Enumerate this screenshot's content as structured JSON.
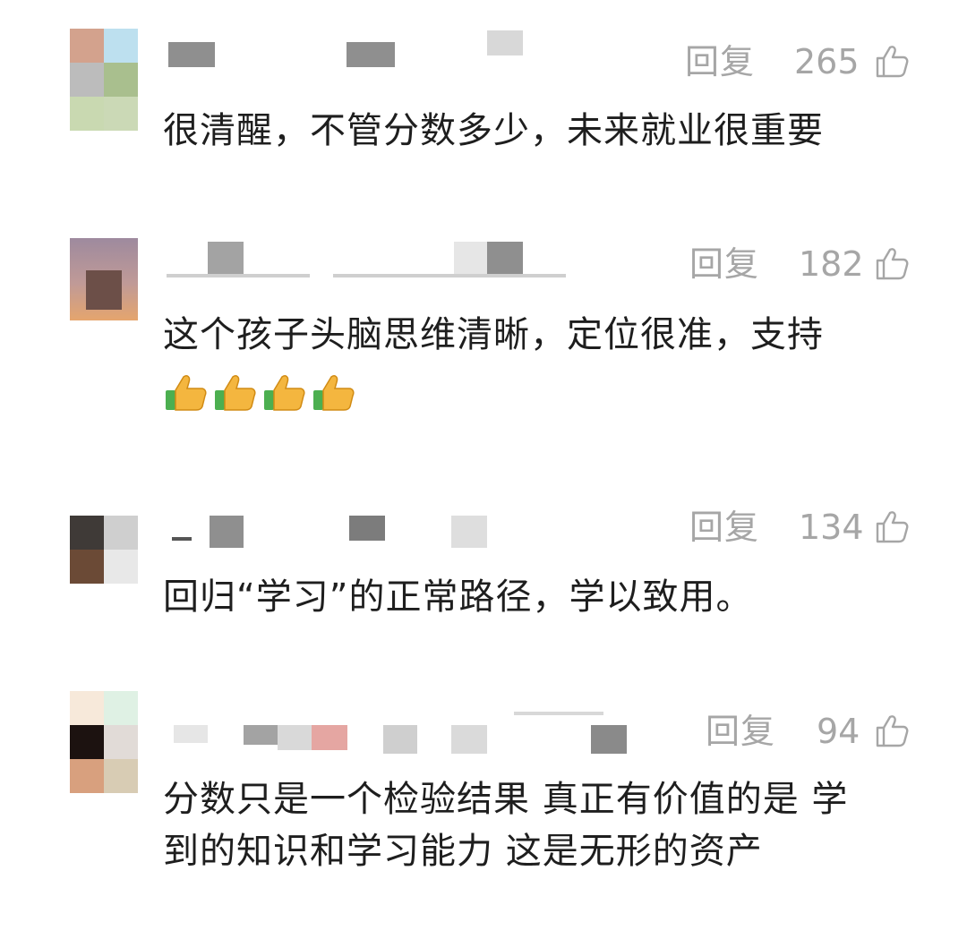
{
  "comments": [
    {
      "reply_label": "回复",
      "likes": "265",
      "text": "很清醒，不管分数多少，未来就业很重要"
    },
    {
      "reply_label": "回复",
      "likes": "182",
      "text": "这个孩子头脑思维清晰，定位很准，支持",
      "emoji": [
        "thumbs-up",
        "thumbs-up",
        "thumbs-up",
        "thumbs-up"
      ]
    },
    {
      "reply_label": "回复",
      "likes": "134",
      "text": "回归“学习”的正常路径，学以致用。"
    },
    {
      "reply_label": "回复",
      "likes": "94",
      "text": "分数只是一个检验结果 真正有价值的是 学\n到的知识和学习能力 这是无形的资产"
    }
  ],
  "icons": {
    "like": "thumbs-up-outline-icon",
    "emoji": "thumbs-up-emoji"
  },
  "colors": {
    "meta_text": "#a6a6a6",
    "body_text": "#1e1e1e",
    "background": "#ffffff"
  }
}
